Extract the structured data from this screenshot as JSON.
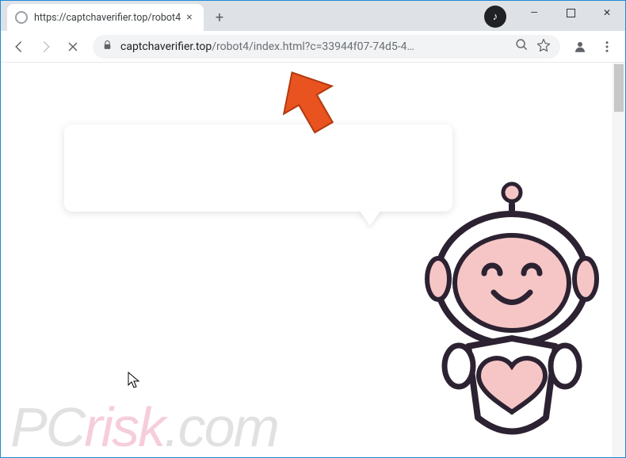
{
  "window": {
    "tab_title": "https://captchaverifier.top/robot4",
    "new_tab_glyph": "+",
    "controls": {
      "minimize": "—",
      "maximize": "▢",
      "close": "✕"
    },
    "music_badge_glyph": "♪"
  },
  "toolbar": {
    "url_host": "captchaverifier.top",
    "url_rest": "/robot4/index.html?c=33944f07-74d5-4…"
  },
  "icons": {
    "back": "arrow-left-icon",
    "forward": "arrow-right-icon",
    "stop": "close-icon",
    "lock": "lock-icon",
    "search": "search-icon",
    "star": "star-icon",
    "profile": "profile-icon",
    "menu": "menu-dots-icon"
  },
  "page": {
    "speech_text": "",
    "watermark_pc": "PC",
    "watermark_risk": "risk",
    "watermark_com": ".com"
  },
  "annotation": {
    "arrow_color": "#e8531f"
  }
}
